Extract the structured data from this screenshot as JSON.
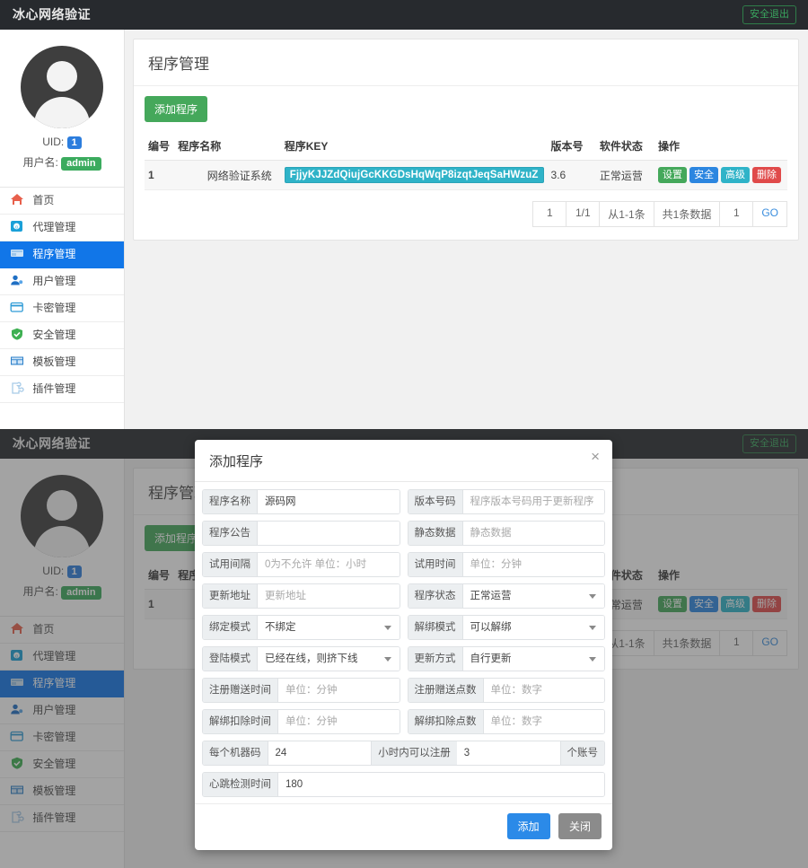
{
  "app": {
    "brand": "冰心网络验证",
    "logout_label": "安全退出"
  },
  "profile": {
    "uid_label": "UID:",
    "uid_value": "1",
    "username_label": "用户名:",
    "username_value": "admin"
  },
  "sidebar": {
    "items": [
      {
        "label": "首页",
        "icon": "home-icon",
        "active": false
      },
      {
        "label": "代理管理",
        "icon": "agent-icon",
        "active": false
      },
      {
        "label": "程序管理",
        "icon": "program-icon",
        "active": true
      },
      {
        "label": "用户管理",
        "icon": "user-icon",
        "active": false
      },
      {
        "label": "卡密管理",
        "icon": "card-icon",
        "active": false
      },
      {
        "label": "安全管理",
        "icon": "shield-icon",
        "active": false
      },
      {
        "label": "模板管理",
        "icon": "template-icon",
        "active": false
      },
      {
        "label": "插件管理",
        "icon": "plugin-icon",
        "active": false
      }
    ]
  },
  "page": {
    "title": "程序管理",
    "add_button": "添加程序"
  },
  "table": {
    "headers": [
      "编号",
      "程序名称",
      "程序KEY",
      "版本号",
      "软件状态",
      "操作"
    ],
    "rows": [
      {
        "no": "1",
        "name": "网络验证系统",
        "key": "FjjyKJJZdQiujGcKKGDsHqWqP8izqtJeqSaHWzuZ",
        "version": "3.6",
        "status": "正常运营",
        "ops": [
          {
            "label": "设置",
            "color": "#45a85b"
          },
          {
            "label": "安全",
            "color": "#2c86e0"
          },
          {
            "label": "高级",
            "color": "#2fb3c8"
          },
          {
            "label": "删除",
            "color": "#e04a4a"
          }
        ]
      }
    ]
  },
  "pagination": {
    "current": "1",
    "pages": "1/1",
    "range": "从1-1条",
    "total": "共1条数据",
    "jump_value": "1",
    "go_label": "GO"
  },
  "modal": {
    "title": "添加程序",
    "close_icon": "×",
    "rows": [
      {
        "left": {
          "label": "程序名称",
          "value": "源码网",
          "placeholder": "",
          "type": "input"
        },
        "right": {
          "label": "版本号码",
          "value": "",
          "placeholder": "程序版本号码用于更新程序",
          "type": "input"
        }
      },
      {
        "left": {
          "label": "程序公告",
          "value": "",
          "placeholder": "",
          "type": "input"
        },
        "right": {
          "label": "静态数据",
          "value": "",
          "placeholder": "静态数据",
          "type": "input"
        }
      },
      {
        "left": {
          "label": "试用间隔",
          "value": "",
          "placeholder": "0为不允许 单位：小时",
          "type": "input"
        },
        "right": {
          "label": "试用时间",
          "value": "",
          "placeholder": "单位：分钟",
          "type": "input"
        }
      },
      {
        "left": {
          "label": "更新地址",
          "value": "",
          "placeholder": "更新地址",
          "type": "input"
        },
        "right": {
          "label": "程序状态",
          "value": "正常运营",
          "placeholder": "",
          "type": "select"
        }
      },
      {
        "left": {
          "label": "绑定模式",
          "value": "不绑定",
          "placeholder": "",
          "type": "select"
        },
        "right": {
          "label": "解绑模式",
          "value": "可以解绑",
          "placeholder": "",
          "type": "select"
        }
      },
      {
        "left": {
          "label": "登陆模式",
          "value": "已经在线，则挤下线",
          "placeholder": "",
          "type": "select"
        },
        "right": {
          "label": "更新方式",
          "value": "自行更新",
          "placeholder": "",
          "type": "select"
        }
      },
      {
        "left": {
          "label": "注册赠送时间",
          "value": "",
          "placeholder": "单位：分钟",
          "type": "input"
        },
        "right": {
          "label": "注册赠送点数",
          "value": "",
          "placeholder": "单位：数字",
          "type": "input"
        }
      },
      {
        "left": {
          "label": "解绑扣除时间",
          "value": "",
          "placeholder": "单位：分钟",
          "type": "input"
        },
        "right": {
          "label": "解绑扣除点数",
          "value": "",
          "placeholder": "单位：数字",
          "type": "input"
        }
      }
    ],
    "machine_row": {
      "label": "每个机器码",
      "value": "24",
      "mid_label": "小时内可以注册",
      "mid_value": "3",
      "suffix_label": "个账号"
    },
    "heartbeat_row": {
      "label": "心跳检测时间",
      "value": "180"
    },
    "submit_label": "添加",
    "close_label": "关闭"
  }
}
